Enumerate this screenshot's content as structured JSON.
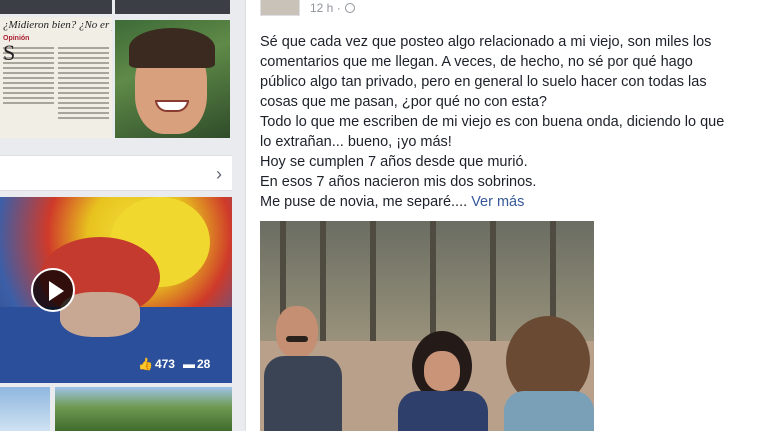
{
  "left": {
    "newspaper": {
      "headline": "¿Midieron bien? ¿No er poco?",
      "section": "Opinión"
    },
    "video": {
      "likes": "473",
      "comments": "28"
    }
  },
  "post": {
    "timestamp": "12 h ·",
    "paragraphs": [
      "Sé que cada vez que posteo algo relacionado a mi viejo, son miles los",
      "comentarios que me llegan. A veces, de hecho, no sé por qué hago",
      "público algo tan privado, pero en general lo suelo hacer con todas las",
      "cosas que me pasan, ¿por qué no con esta?",
      "Todo lo que me escriben de mi viejo es con buena onda, diciendo lo que",
      "lo extrañan... bueno, ¡yo más!",
      "Hoy se cumplen 7 años desde que murió.",
      "En esos 7 años nacieron mis dos sobrinos."
    ],
    "last_line": "Me puse de novia, me separé....",
    "see_more": "Ver más"
  },
  "icons": {
    "globe": "globe-icon",
    "chevron": "chevron-right-icon",
    "play": "play-icon",
    "like": "thumbs-up-icon",
    "comment": "comment-icon"
  },
  "colors": {
    "link": "#365899",
    "text": "#1d2129",
    "meta": "#90949c",
    "background": "#e9ebee"
  }
}
